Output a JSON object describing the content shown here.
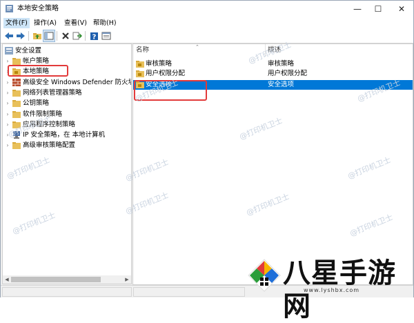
{
  "window": {
    "title": "本地安全策略",
    "controls": {
      "minimize": "—",
      "maximize": "☐",
      "close": "✕"
    }
  },
  "menu": [
    {
      "label": "文件(F)"
    },
    {
      "label": "操作(A)"
    },
    {
      "label": "查看(V)"
    },
    {
      "label": "帮助(H)"
    }
  ],
  "toolbar": {
    "icons": [
      "back-arrow-icon",
      "forward-arrow-icon",
      "up-folder-icon",
      "show-tree-icon",
      "delete-icon",
      "export-list-icon",
      "help-icon",
      "console-view-icon"
    ]
  },
  "tree": {
    "root": "安全设置",
    "items": [
      {
        "label": "帐户策略"
      },
      {
        "label": "本地策略"
      },
      {
        "label": "高级安全 Windows Defender 防火墙"
      },
      {
        "label": "网络列表管理器策略"
      },
      {
        "label": "公钥策略"
      },
      {
        "label": "软件限制策略"
      },
      {
        "label": "应用程序控制策略"
      },
      {
        "label": "IP 安全策略，在 本地计算机"
      },
      {
        "label": "高级审核策略配置"
      }
    ]
  },
  "list": {
    "columns": {
      "name": "名称",
      "description": "描述"
    },
    "rows": [
      {
        "name": "审核策略",
        "description": "审核策略",
        "selected": false
      },
      {
        "name": "用户权限分配",
        "description": "用户权限分配",
        "selected": false
      },
      {
        "name": "安全选项",
        "description": "安全选项",
        "selected": true
      }
    ]
  },
  "watermark": "@打印机卫士",
  "brand": {
    "name": "八星手游网",
    "url": "www.lyshbx.com"
  },
  "colors": {
    "selection": "#0078d7",
    "highlight_box": "#e23a3a",
    "folder": "#e8c05a"
  }
}
